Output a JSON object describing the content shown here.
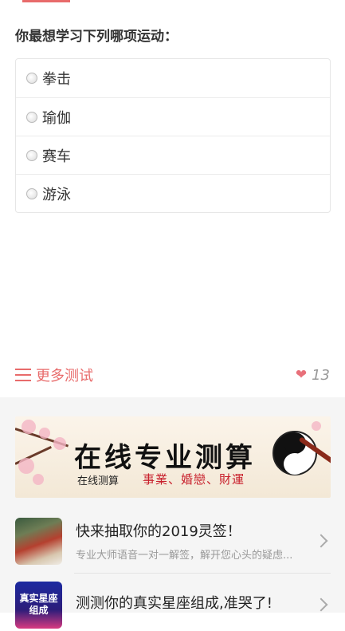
{
  "quiz": {
    "question": "你最想学习下列哪项运动：",
    "options": [
      {
        "label": "拳击"
      },
      {
        "label": "瑜伽"
      },
      {
        "label": "赛车"
      },
      {
        "label": "游泳"
      }
    ]
  },
  "footer_bar": {
    "more_label": "更多测试",
    "like_count": "13"
  },
  "banner": {
    "title": "在线专业测算",
    "subtitle": "在线测算",
    "tags": "事業、婚戀、財運"
  },
  "recommendations": [
    {
      "title": "快来抽取你的2019灵签！",
      "desc": "专业大师语音一对一解签，解开您心头的疑虑..."
    },
    {
      "title": "测测你的真实星座组成,准哭了!",
      "desc": "",
      "thumb_text": "真实星座组成"
    }
  ],
  "colors": {
    "accent": "#e86b6b",
    "heart": "#e8707a"
  }
}
